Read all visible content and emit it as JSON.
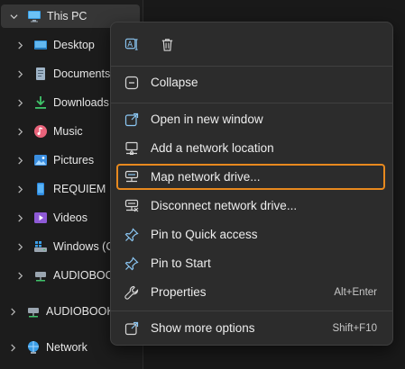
{
  "nav": {
    "this_pc": "This PC",
    "items": [
      {
        "label": "Desktop",
        "icon": "desktop-folder-icon"
      },
      {
        "label": "Documents",
        "icon": "documents-folder-icon"
      },
      {
        "label": "Downloads",
        "icon": "downloads-folder-icon"
      },
      {
        "label": "Music",
        "icon": "music-folder-icon"
      },
      {
        "label": "Pictures",
        "icon": "pictures-folder-icon"
      },
      {
        "label": "REQUIEM",
        "icon": "phone-device-icon"
      },
      {
        "label": "Videos",
        "icon": "videos-folder-icon"
      },
      {
        "label": "Windows (C",
        "icon": "windows-drive-icon"
      },
      {
        "label": "AUDIOBOOK",
        "icon": "network-drive-icon"
      }
    ],
    "audiobooks": "AUDIOBOOKS",
    "network": "Network"
  },
  "menu": {
    "top_buttons": [
      "rename-icon",
      "delete-icon"
    ],
    "collapse": "Collapse",
    "open_new_window": "Open in new window",
    "add_network_location": "Add a network location",
    "map_network_drive": "Map network drive...",
    "disconnect_network_drive": "Disconnect network drive...",
    "pin_quick_access": "Pin to Quick access",
    "pin_start": "Pin to Start",
    "properties": "Properties",
    "properties_shortcut": "Alt+Enter",
    "show_more_options": "Show more options",
    "show_more_shortcut": "Shift+F10"
  },
  "colors": {
    "highlight_outline": "#e8891e",
    "menu_bg": "#2c2c2c",
    "accent_blue": "#4aa3e6"
  }
}
